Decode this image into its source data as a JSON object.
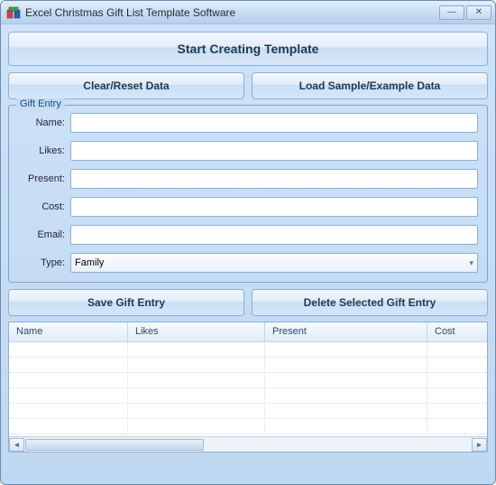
{
  "window": {
    "title": "Excel Christmas Gift List Template Software"
  },
  "buttons": {
    "start": "Start Creating Template",
    "clear": "Clear/Reset Data",
    "load": "Load Sample/Example Data",
    "save": "Save Gift Entry",
    "delete": "Delete Selected Gift Entry"
  },
  "fieldset": {
    "legend": "Gift Entry",
    "fields": {
      "name": {
        "label": "Name:",
        "value": ""
      },
      "likes": {
        "label": "Likes:",
        "value": ""
      },
      "present": {
        "label": "Present:",
        "value": ""
      },
      "cost": {
        "label": "Cost:",
        "value": ""
      },
      "email": {
        "label": "Email:",
        "value": ""
      },
      "type": {
        "label": "Type:",
        "value": "Family"
      }
    }
  },
  "grid": {
    "columns": {
      "name": "Name",
      "likes": "Likes",
      "present": "Present",
      "cost": "Cost"
    }
  }
}
